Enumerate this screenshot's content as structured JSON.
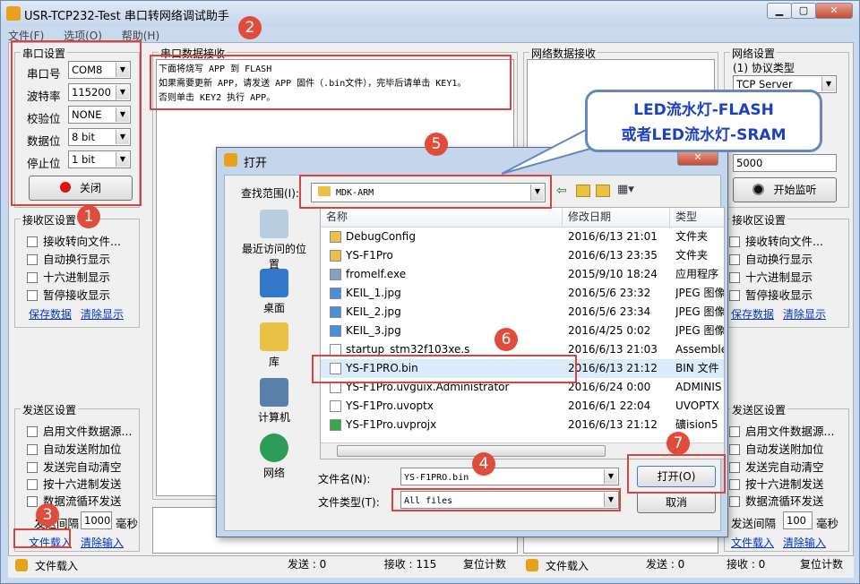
{
  "window": {
    "title": "USR-TCP232-Test 串口转网络调试助手",
    "min": "▁",
    "max": "▢",
    "close": "✕"
  },
  "menu": [
    "文件(F)",
    "选项(O)",
    "帮助(H)"
  ],
  "serial": {
    "group_title": "串口设置",
    "port_label": "串口号",
    "port_value": "COM8",
    "baud_label": "波特率",
    "baud_value": "115200",
    "parity_label": "校验位",
    "parity_value": "NONE",
    "data_label": "数据位",
    "data_value": "8 bit",
    "stop_label": "停止位",
    "stop_value": "1 bit",
    "close_button": "关闭"
  },
  "recv_settings": {
    "title": "接收区设置",
    "options": [
      "接收转向文件...",
      "自动换行显示",
      "十六进制显示",
      "暂停接收显示"
    ],
    "save": "保存数据",
    "clear": "清除显示"
  },
  "send_settings": {
    "title": "发送区设置",
    "options": [
      "启用文件数据源...",
      "自动发送附加位",
      "发送完自动清空",
      "按十六进制发送",
      "数据流循环发送"
    ],
    "interval_label": "发送间隔",
    "interval_value": "1000",
    "interval_unit": "毫秒",
    "load_file": "文件载入",
    "clear_input": "清除输入"
  },
  "serial_recv": {
    "title": "串口数据接收",
    "lines": [
      "下面将烧写 APP 到 FLASH",
      "如果需要更新 APP，请发送 APP 固件（.bin文件），完毕后请单击 KEY1。",
      "否则单击 KEY2 执行 APP。"
    ]
  },
  "net_recv": {
    "title": "网络数据接收"
  },
  "net_settings": {
    "title": "网络设置",
    "protocol_label": "(1) 协议类型",
    "protocol_value": "TCP Server",
    "port_value": "5000",
    "start_button": "开始监听",
    "recv_title": "接收区设置",
    "recv_options": [
      "接收转向文件...",
      "自动换行显示",
      "十六进制显示",
      "暂停接收显示"
    ],
    "save": "保存数据",
    "clear": "清除显示",
    "send_title": "发送区设置",
    "send_options": [
      "启用文件数据源...",
      "自动发送附加位",
      "发送完自动清空",
      "按十六进制发送",
      "数据流循环发送"
    ],
    "interval_label": "发送间隔",
    "interval_value": "100",
    "interval_unit": "毫秒",
    "load_file": "文件载入",
    "clear_input": "清除输入"
  },
  "status": {
    "left_file": "文件载入",
    "send": "发送 : 0",
    "recv": "接收 : 115",
    "reset": "复位计数",
    "right_file": "文件载入",
    "send2": "发送 : 0",
    "recv2": "接收 : 0",
    "reset2": "复位计数"
  },
  "dialog": {
    "title": "打开",
    "lookin_label": "查找范围(I):",
    "lookin_value": "MDK-ARM",
    "places": [
      "最近访问的位置",
      "桌面",
      "库",
      "计算机",
      "网络"
    ],
    "columns": [
      "名称",
      "修改日期",
      "类型"
    ],
    "files": [
      {
        "name": "DebugConfig",
        "date": "2016/6/13 21:01",
        "type": "文件夹",
        "icon": "folder-icon"
      },
      {
        "name": "YS-F1Pro",
        "date": "2016/6/13 23:35",
        "type": "文件夹",
        "icon": "folder-icon"
      },
      {
        "name": "fromelf.exe",
        "date": "2015/9/10 18:24",
        "type": "应用程序",
        "icon": "exe-icon"
      },
      {
        "name": "KEIL_1.jpg",
        "date": "2016/5/6 23:32",
        "type": "JPEG 图像",
        "icon": "image-icon"
      },
      {
        "name": "KEIL_2.jpg",
        "date": "2016/5/6 23:34",
        "type": "JPEG 图像",
        "icon": "image-icon"
      },
      {
        "name": "KEIL_3.jpg",
        "date": "2016/4/25 0:02",
        "type": "JPEG 图像",
        "icon": "image-icon"
      },
      {
        "name": "startup_stm32f103xe.s",
        "date": "2016/6/13 21:03",
        "type": "Assembler",
        "icon": "file-icon"
      },
      {
        "name": "YS-F1PRO.bin",
        "date": "2016/6/13 21:12",
        "type": "BIN 文件",
        "icon": "file-icon"
      },
      {
        "name": "YS-F1Pro.uvguix.Administrator",
        "date": "2016/6/24 0:00",
        "type": "ADMINIS",
        "icon": "file-icon"
      },
      {
        "name": "YS-F1Pro.uvoptx",
        "date": "2016/6/1 22:04",
        "type": "UVOPTX",
        "icon": "file-icon"
      },
      {
        "name": "YS-F1Pro.uvprojx",
        "date": "2016/6/13 21:12",
        "type": "礦ision5",
        "icon": "project-icon"
      }
    ],
    "filename_label": "文件名(N):",
    "filename_value": "YS-F1PRO.bin",
    "filetype_label": "文件类型(T):",
    "filetype_value": "All files",
    "open_button": "打开(O)",
    "cancel_button": "取消"
  },
  "annotation": {
    "bubble_line1": "LED流水灯-FLASH",
    "bubble_line2": "或者LED流水灯-SRAM",
    "numbers": [
      "1",
      "2",
      "3",
      "4",
      "5",
      "6",
      "7"
    ]
  },
  "colors": {
    "callout": "#e04c3c",
    "accent": "#1d40c0"
  }
}
